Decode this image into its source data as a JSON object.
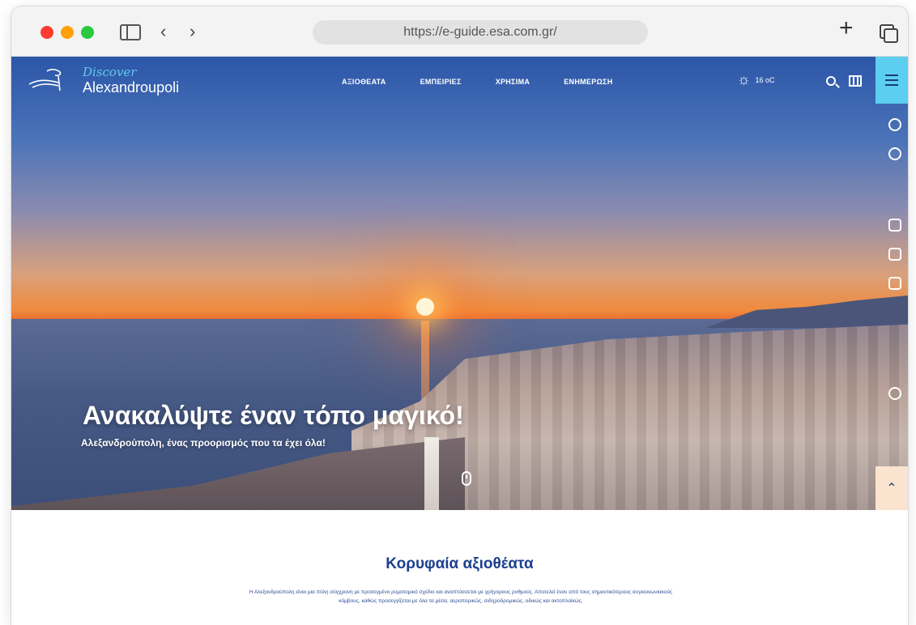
{
  "browser": {
    "url": "https://e-guide.esa.com.gr/",
    "icons": [
      "sidebar-toggle-icon",
      "back-arrow-icon",
      "forward-arrow-icon",
      "new-tab-plus-icon",
      "tabs-overview-icon"
    ]
  },
  "site": {
    "logo": {
      "discover": "Discover",
      "city": "Alexandroupoli"
    },
    "nav": [
      {
        "label": "ΑΞΙΟΘΕΑΤΑ"
      },
      {
        "label": "ΕΜΠΕΙΡΙΕΣ"
      },
      {
        "label": "ΧΡΗΣΙΜΑ"
      },
      {
        "label": "ΕΝΗΜΕΡΩΣΗ"
      }
    ],
    "weather": {
      "temp": "16 oC",
      "icon": "sun-icon"
    },
    "accent_color": "#5ccff0",
    "brand_color": "#1c3f8f"
  },
  "hero": {
    "title": "Ανακαλύψτε έναν τόπο μαγικό!",
    "subtitle": "Αλεξανδρούπολη, ένας προορισμός που τα έχει όλα!"
  },
  "section": {
    "title": "Κορυφαία αξιοθέατα",
    "text": "Η Αλεξανδρούπολη είναι μια πόλη σύγχρονη με προσεγμένο ρυμοτομικό σχέδιο και αναπτύσσεται με γρήγορους ρυθμούς. Αποτελεί έναν από τους σημαντικότερους συγκοινωνιακούς κόμβους, καθώς προσεγγίζεται με όλα τα μέσα, αεροπορικώς, σιδηροδρομικώς, οδικώς και ακτοπλοϊκώς."
  }
}
